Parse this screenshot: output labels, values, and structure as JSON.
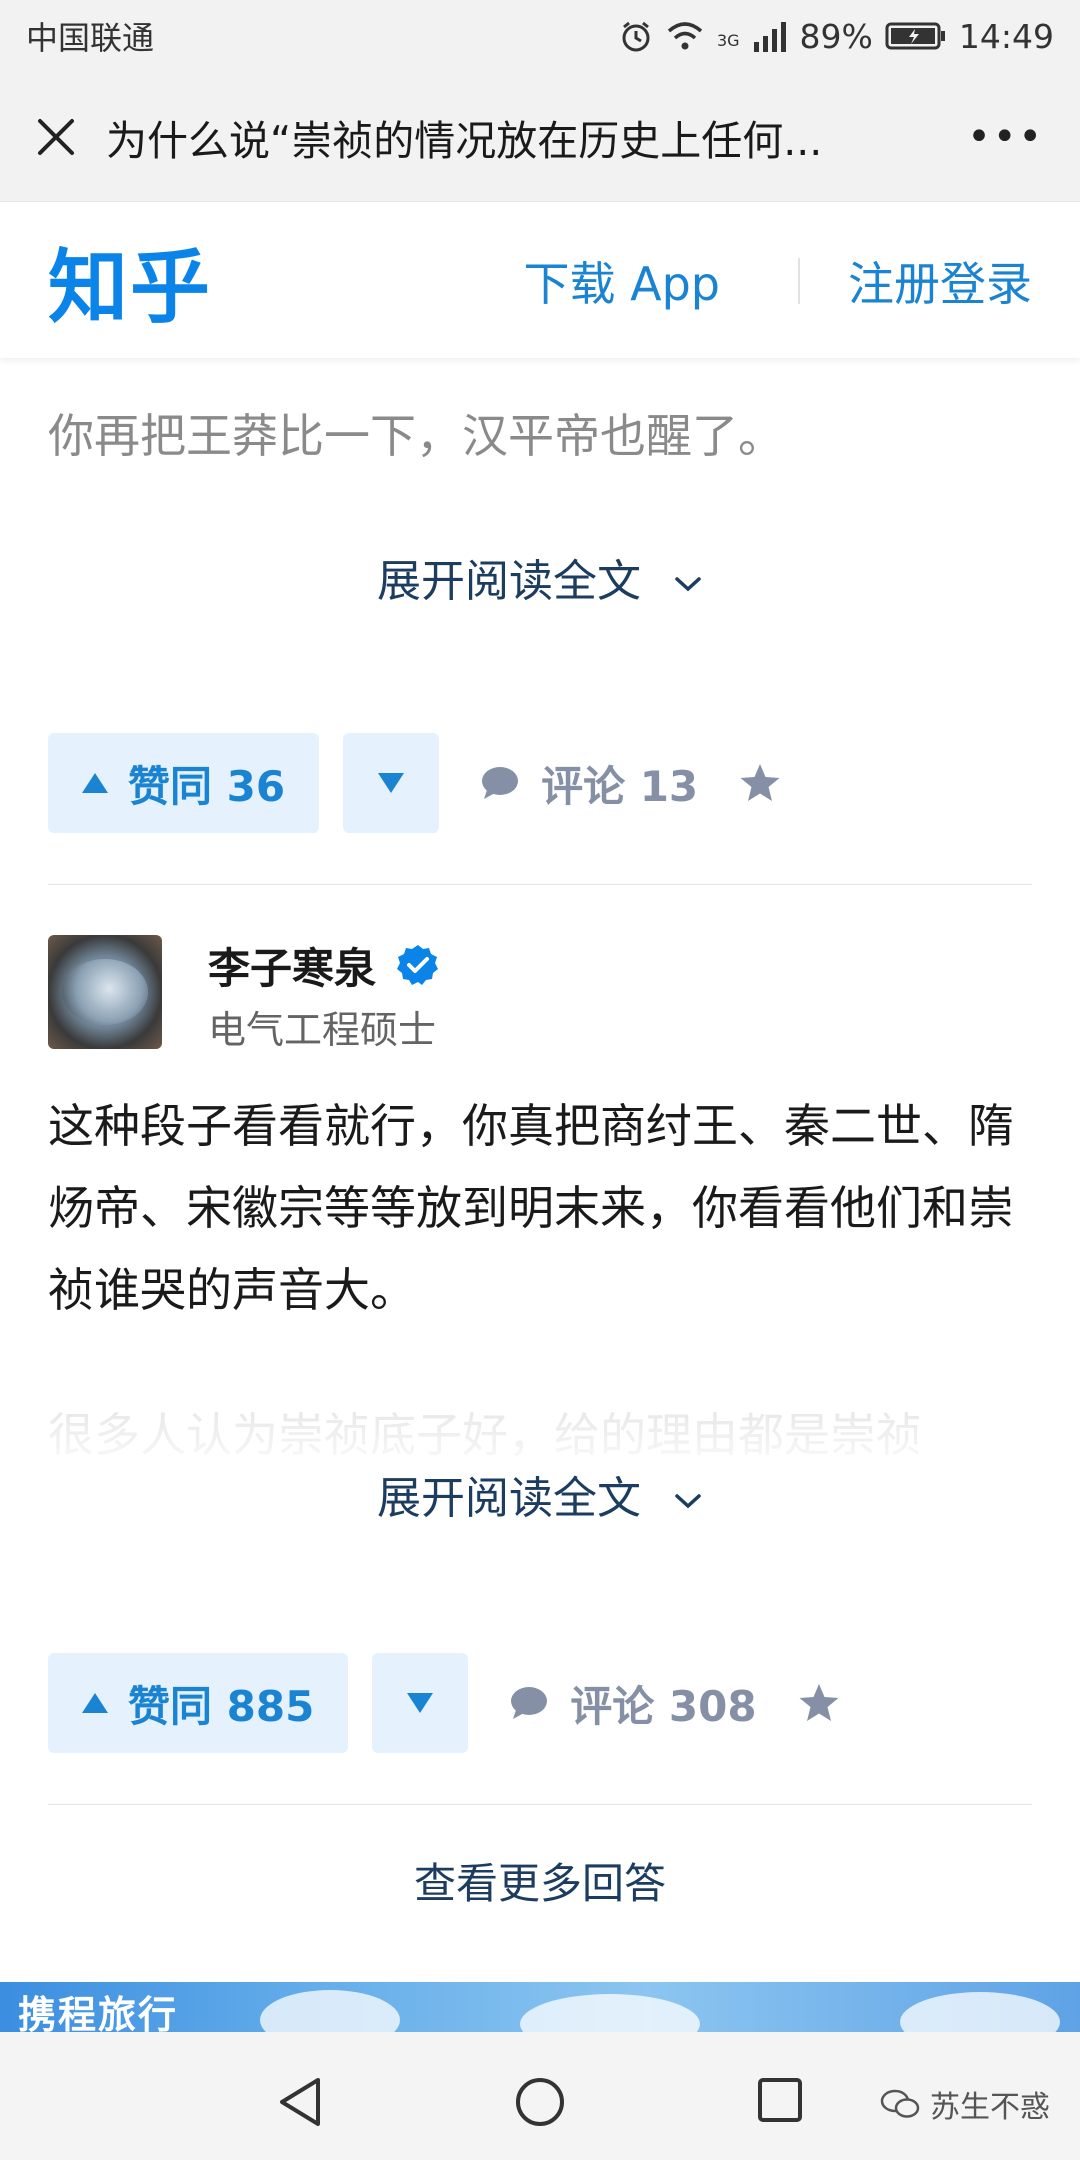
{
  "status_bar": {
    "carrier": "中国联通",
    "network": "3G",
    "battery": "89%",
    "time": "14:49"
  },
  "browser_bar": {
    "title": "为什么说“崇祯的情况放在历史上任何...",
    "more_label": "•••"
  },
  "zhihu_header": {
    "logo": "知乎",
    "download_label": "下载 App",
    "login_label": "注册登录"
  },
  "answer1": {
    "faded_text": "你再把王莽比一下，汉平帝也醒了。",
    "expand_label": "展开阅读全文",
    "vote_label": "赞同 36",
    "comment_label": "评论 13"
  },
  "answer2": {
    "author_name": "李子寒泉",
    "author_headline": "电气工程硕士",
    "text": "这种段子看看就行，你真把商纣王、秦二世、隋炀帝、宋徽宗等等放到明末来，你看看他们和崇祯谁哭的声音大。",
    "faded_text": "很多人认为崇祯底子好，给的理由都是崇祯",
    "expand_label": "展开阅读全文",
    "vote_label": "赞同 885",
    "comment_label": "评论 308"
  },
  "more_answers_label": "查看更多回答",
  "ad": {
    "text": "携程旅行"
  },
  "watermark": {
    "text": "苏生不惑"
  },
  "colors": {
    "zhihu_blue": "#0a84e8",
    "link_blue": "#1a84d3",
    "vote_bg": "#e5f2fd",
    "expand_text": "#1c3c60",
    "muted": "#8590a6"
  }
}
